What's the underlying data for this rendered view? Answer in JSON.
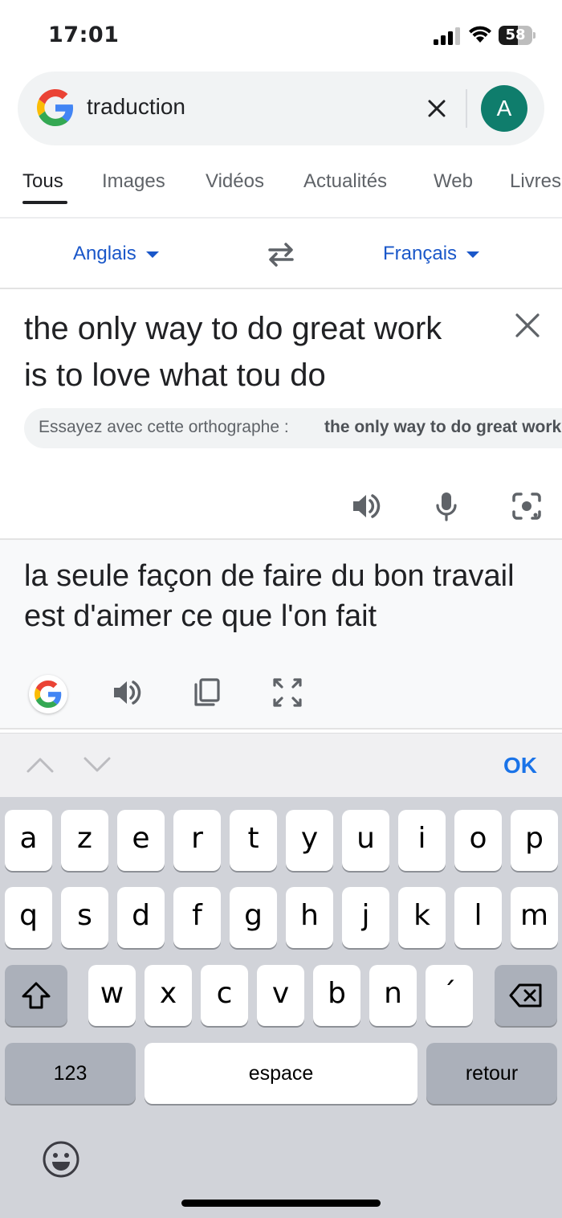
{
  "status_bar": {
    "time": "17:01",
    "battery_level": "58",
    "battery_fraction": 0.58
  },
  "search": {
    "query": "traduction",
    "avatar_letter": "A"
  },
  "tabs": [
    {
      "label": "Tous",
      "active": true
    },
    {
      "label": "Images"
    },
    {
      "label": "Vidéos"
    },
    {
      "label": "Actualités"
    },
    {
      "label": "Web"
    },
    {
      "label": "Livres"
    }
  ],
  "translator": {
    "source_lang": "Anglais",
    "target_lang": "Français",
    "source_text": "the only way to do great work is to love what tou do",
    "suggestion_label": "Essayez avec cette orthographe :",
    "suggestion_value": "the only way to do great work is to love what you do",
    "target_text": "la seule façon de faire du bon travail est d'aimer ce que l'on fait"
  },
  "accessory": {
    "ok_label": "OK"
  },
  "keyboard": {
    "row1": [
      "a",
      "z",
      "e",
      "r",
      "t",
      "y",
      "u",
      "i",
      "o",
      "p"
    ],
    "row2": [
      "q",
      "s",
      "d",
      "f",
      "g",
      "h",
      "j",
      "k",
      "l",
      "m"
    ],
    "row3": [
      "w",
      "x",
      "c",
      "v",
      "b",
      "n",
      "´"
    ],
    "numbers_label": "123",
    "space_label": "espace",
    "return_label": "retour"
  },
  "colors": {
    "accent": "#1a73e8",
    "lang_blue": "#1a57c9",
    "avatar": "#0f7d6c"
  }
}
